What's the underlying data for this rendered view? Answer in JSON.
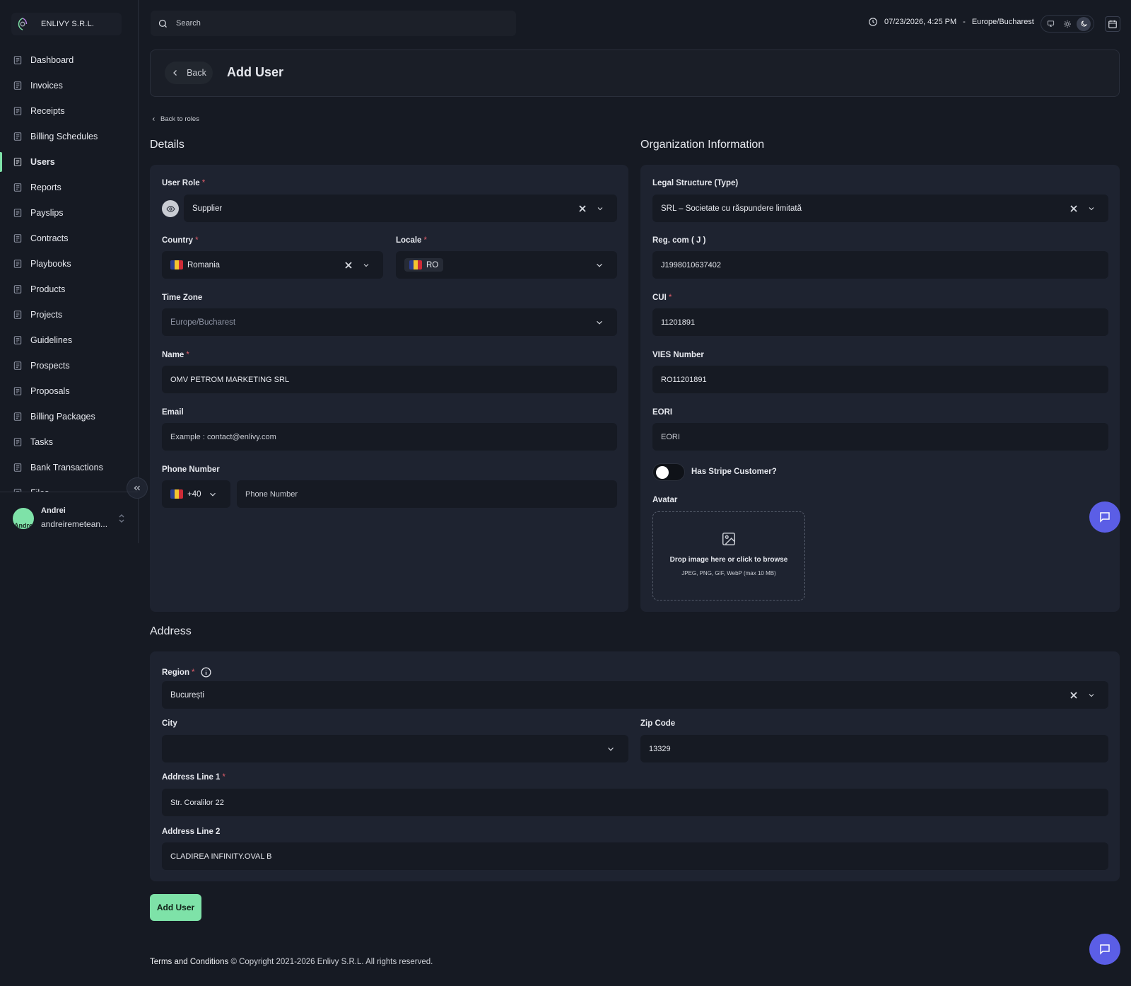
{
  "brand": {
    "name": "ENLIVY S.R.L."
  },
  "nav": {
    "items": [
      {
        "label": "Dashboard",
        "icon": "dashboard-icon"
      },
      {
        "label": "Invoices",
        "icon": "invoice-icon"
      },
      {
        "label": "Receipts",
        "icon": "receipt-icon"
      },
      {
        "label": "Billing Schedules",
        "icon": "schedule-icon"
      },
      {
        "label": "Users",
        "icon": "users-icon",
        "active": true
      },
      {
        "label": "Reports",
        "icon": "report-icon"
      },
      {
        "label": "Payslips",
        "icon": "payslip-icon"
      },
      {
        "label": "Contracts",
        "icon": "contract-icon"
      },
      {
        "label": "Playbooks",
        "icon": "playbook-icon"
      },
      {
        "label": "Products",
        "icon": "product-icon"
      },
      {
        "label": "Projects",
        "icon": "project-icon"
      },
      {
        "label": "Guidelines",
        "icon": "guideline-icon"
      },
      {
        "label": "Prospects",
        "icon": "prospect-icon"
      },
      {
        "label": "Proposals",
        "icon": "proposal-icon"
      },
      {
        "label": "Billing Packages",
        "icon": "package-icon"
      },
      {
        "label": "Tasks",
        "icon": "task-icon"
      },
      {
        "label": "Bank Transactions",
        "icon": "bank-icon"
      },
      {
        "label": "Files",
        "icon": "file-icon"
      }
    ]
  },
  "user": {
    "name": "Andrei",
    "email": "andreiremetean...",
    "avatar_text": "Andre"
  },
  "search": {
    "placeholder": "Search"
  },
  "clock": {
    "datetime": "07/23/2026, 4:25 PM",
    "separator": "-",
    "timezone": "Europe/Bucharest"
  },
  "header": {
    "back_label": "Back",
    "title": "Add User"
  },
  "back_to_roles": "Back to roles",
  "details": {
    "title": "Details",
    "user_role": {
      "label": "User Role",
      "value": "Supplier"
    },
    "country": {
      "label": "Country",
      "value": "Romania"
    },
    "locale": {
      "label": "Locale",
      "value": "RO"
    },
    "time_zone": {
      "label": "Time Zone",
      "value": "Europe/Bucharest"
    },
    "name": {
      "label": "Name",
      "value": "OMV PETROM MARKETING SRL"
    },
    "email": {
      "label": "Email",
      "placeholder": "Example : contact@enlivy.com"
    },
    "phone": {
      "label": "Phone Number",
      "prefix": "+40",
      "placeholder": "Phone Number"
    }
  },
  "org": {
    "title": "Organization Information",
    "legal_structure": {
      "label": "Legal Structure (Type)",
      "value": "SRL – Societate cu răspundere limitată"
    },
    "reg_com": {
      "label": "Reg. com ( J )",
      "value": "J1998010637402"
    },
    "cui": {
      "label": "CUI",
      "value": "11201891"
    },
    "vies": {
      "label": "VIES Number",
      "value": "RO11201891"
    },
    "eori": {
      "label": "EORI",
      "placeholder": "EORI"
    },
    "stripe": {
      "label": "Has Stripe Customer?",
      "enabled": false
    },
    "avatar": {
      "label": "Avatar",
      "drop_text": "Drop image here or click to browse",
      "hint": "JPEG, PNG, GIF, WebP (max 10 MB)"
    }
  },
  "address": {
    "title": "Address",
    "region": {
      "label": "Region",
      "value": "București"
    },
    "city": {
      "label": "City",
      "value": ""
    },
    "zip": {
      "label": "Zip Code",
      "value": "13329"
    },
    "line1": {
      "label": "Address Line 1",
      "value": "Str. Coralilor 22"
    },
    "line2": {
      "label": "Address Line 2",
      "value": "CLADIREA INFINITY.OVAL B"
    }
  },
  "submit_label": "Add User",
  "footer": {
    "terms": "Terms and Conditions",
    "copyright": "© Copyright 2021-2026 Enlivy S.R.L. All rights reserved."
  },
  "colors": {
    "background": "#161a23",
    "card": "#1e2330",
    "accent": "#7ee2a8",
    "chat": "#5b5ee6",
    "required": "#e05d6a"
  }
}
